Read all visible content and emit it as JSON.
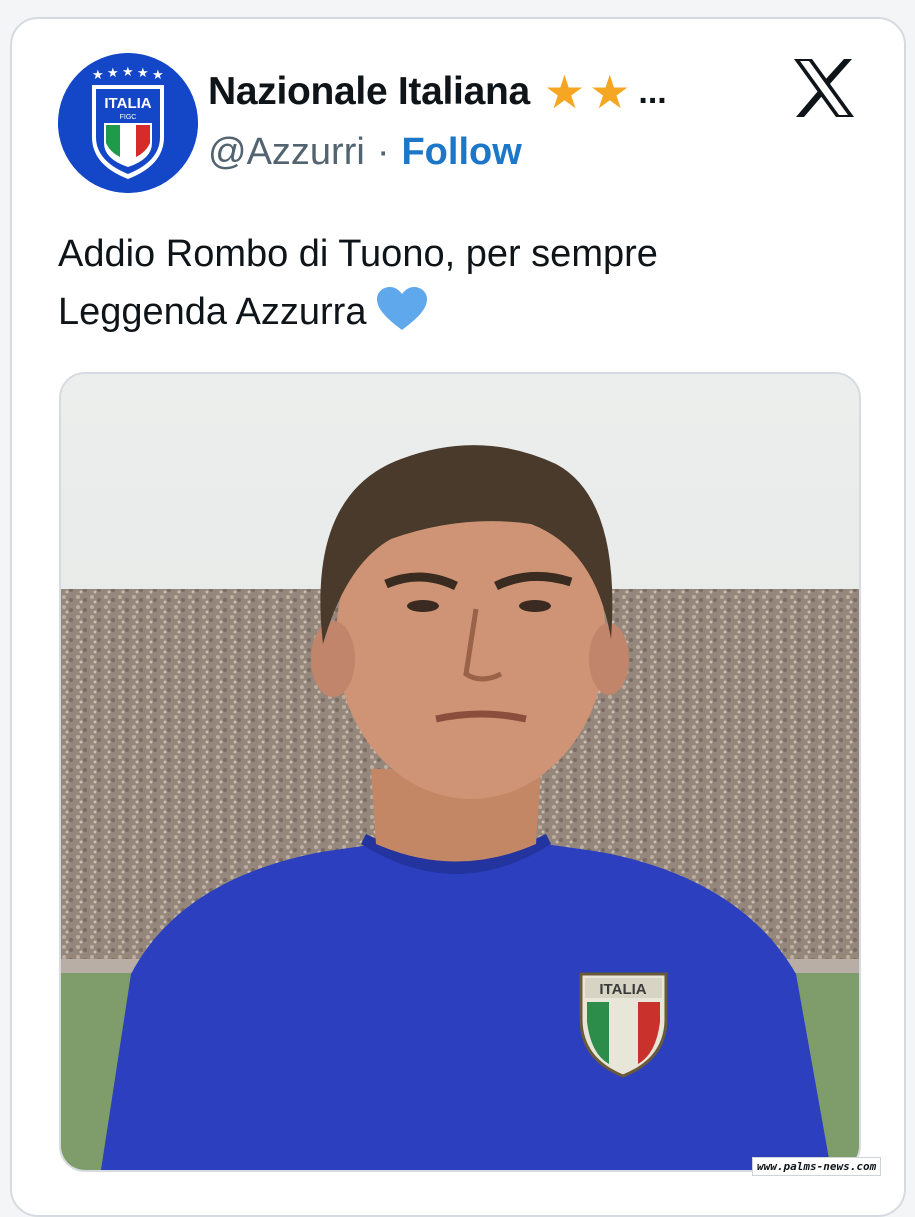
{
  "tweet": {
    "display_name": "Nazionale Italiana",
    "badges": [
      "star-icon",
      "star-icon"
    ],
    "more_indicator": "...",
    "handle": "@Azzurri",
    "separator": "·",
    "follow_label": "Follow",
    "text_line1": "Addio Rombo di Tuono, per sempre",
    "text_line2": "Leggenda Azzurra",
    "emoji": "blue-heart-icon",
    "platform_logo": "x-logo-icon"
  },
  "avatar": {
    "badge_text": "ITALIA",
    "sub_text": "FIGC"
  },
  "media": {
    "crest_text": "ITALIA"
  },
  "watermark": "www.palms-news.com",
  "colors": {
    "accent_link": "#1d77c8",
    "avatar_blue": "#1447c8",
    "star": "#f5a623",
    "heart": "#5fa8ec",
    "jersey_blue": "#2b3fbf"
  }
}
